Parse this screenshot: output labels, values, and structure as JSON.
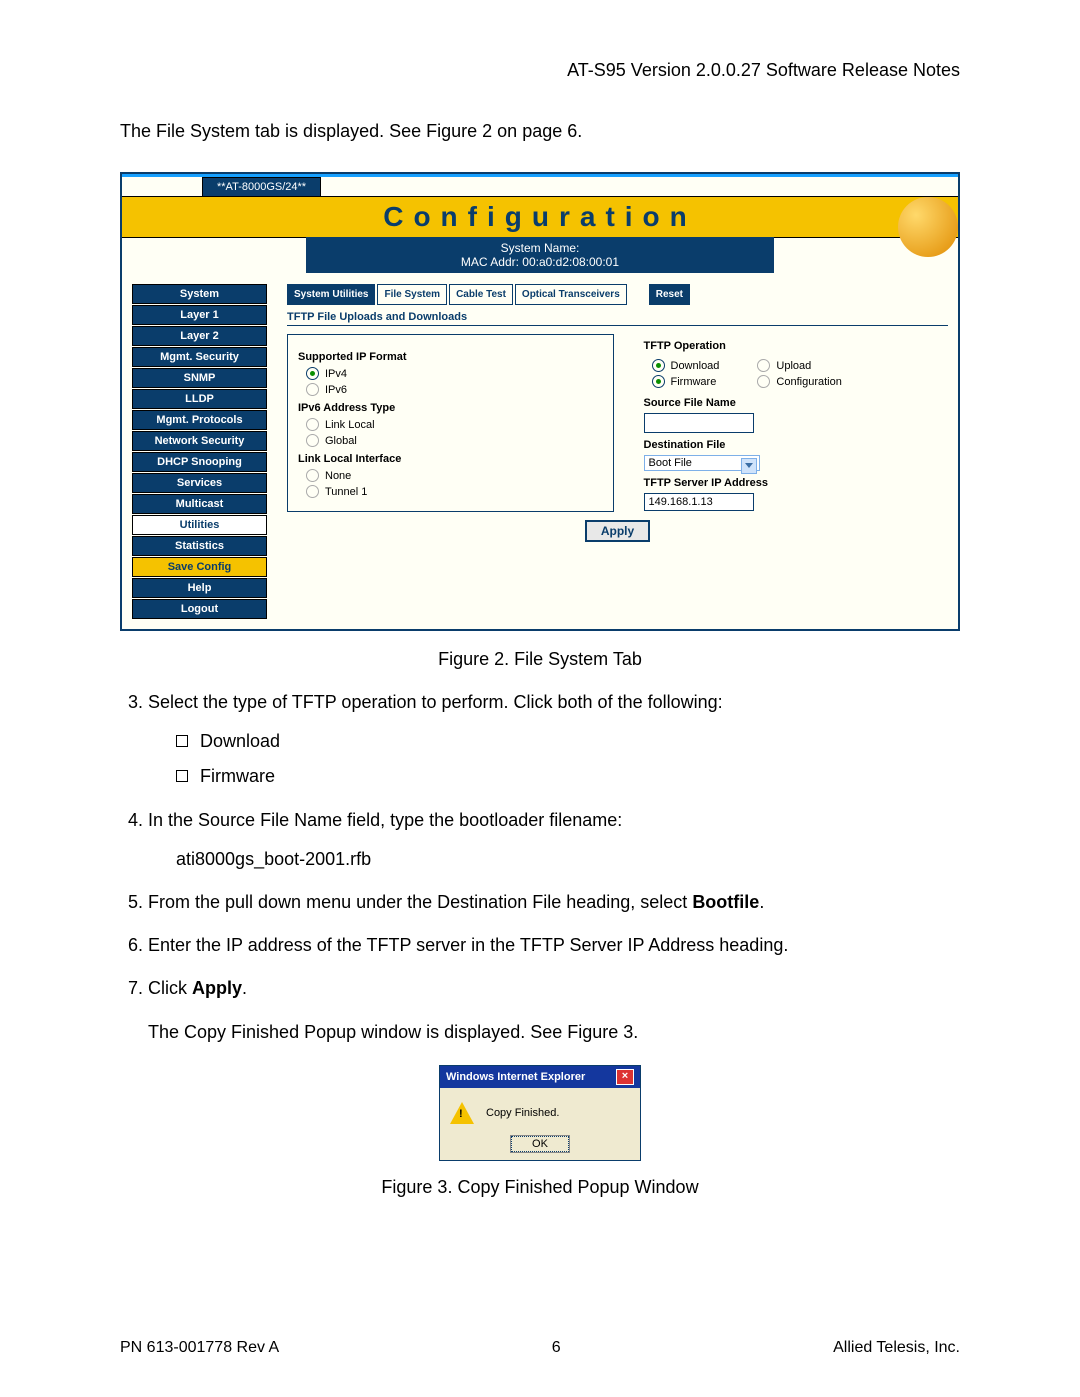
{
  "header": "AT-S95 Version 2.0.0.27 Software Release Notes",
  "intro": "The File System tab is displayed. See Figure 2 on page 6.",
  "fig2": {
    "device": "**AT-8000GS/24**",
    "title": "Configuration",
    "sysname_label": "System Name:",
    "mac_label": "MAC Addr:  00:a0:d2:08:00:01",
    "sidebar": [
      "System",
      "Layer 1",
      "Layer 2",
      "Mgmt. Security",
      "SNMP",
      "LLDP",
      "Mgmt. Protocols",
      "Network Security",
      "DHCP Snooping",
      "Services",
      "Multicast",
      "Utilities",
      "Statistics",
      "Save Config",
      "Help",
      "Logout"
    ],
    "tabs": [
      "System Utilities",
      "File System",
      "Cable Test",
      "Optical Transceivers",
      "Reset"
    ],
    "section_title": "TFTP File Uploads and Downloads",
    "left": {
      "sup_title": "Supported IP Format",
      "ipv4": "IPv4",
      "ipv6": "IPv6",
      "addr_title": "IPv6 Address Type",
      "linklocal": "Link Local",
      "global": "Global",
      "iface_title": "Link Local Interface",
      "none": "None",
      "tunnel1": "Tunnel 1"
    },
    "right": {
      "op_title": "TFTP Operation",
      "download": "Download",
      "upload": "Upload",
      "firmware": "Firmware",
      "configuration": "Configuration",
      "src_title": "Source File Name",
      "src_value": "",
      "dest_title": "Destination File",
      "dest_value": "Boot File",
      "srv_title": "TFTP Server IP Address",
      "srv_value": "149.168.1.13"
    },
    "apply": "Apply",
    "caption": "Figure 2. File System Tab"
  },
  "steps": {
    "s3": "Select the type of TFTP operation to perform. Click both of the following:",
    "s3a": "Download",
    "s3b": "Firmware",
    "s4": "In the Source File Name field, type the bootloader filename:",
    "s4code": "ati8000gs_boot-2001.rfb",
    "s5a": "From the pull down menu under the Destination File heading, select ",
    "s5b": "Bootfile",
    "s6": "Enter the IP address of the TFTP server in the TFTP Server IP Address heading.",
    "s7a": "Click ",
    "s7b": "Apply",
    "s7c": "The Copy Finished Popup window is displayed. See Figure 3."
  },
  "fig3": {
    "title": "Windows Internet Explorer",
    "msg": "Copy Finished.",
    "ok": "OK",
    "caption": "Figure 3. Copy Finished Popup Window"
  },
  "footer": {
    "left": "PN 613-001778 Rev A",
    "center": "6",
    "right": "Allied Telesis, Inc."
  }
}
